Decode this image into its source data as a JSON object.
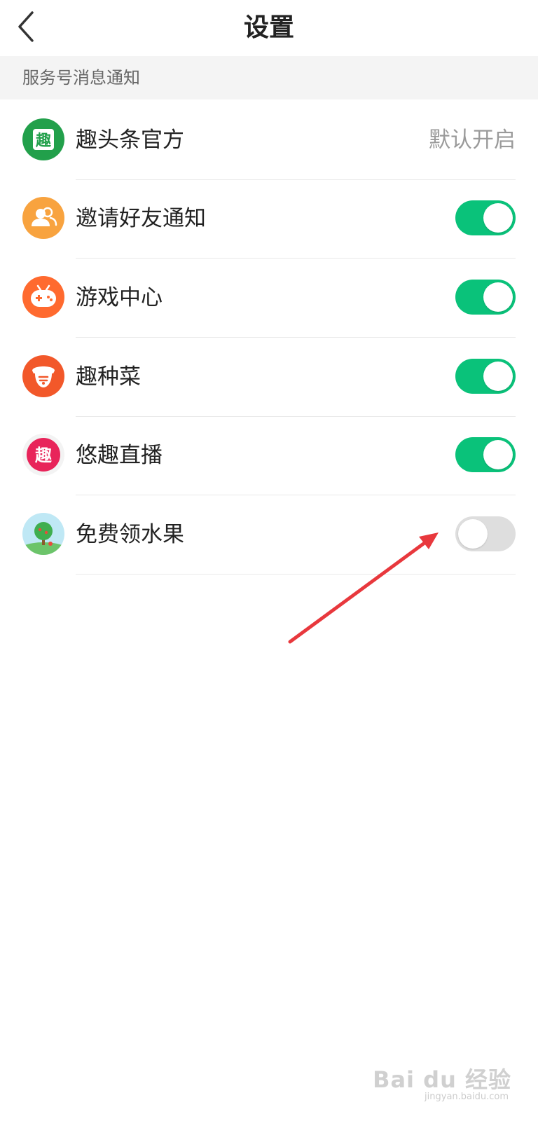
{
  "header": {
    "title": "设置",
    "back_icon": "chevron-left-icon"
  },
  "section": {
    "title": "服务号消息通知"
  },
  "rows": [
    {
      "label": "趣头条官方",
      "status_text": "默认开启",
      "icon": "qutoutiao-logo-icon",
      "icon_glyph": "趣",
      "icon_color": "#22a04b",
      "control": "status"
    },
    {
      "label": "邀请好友通知",
      "toggle_on": true,
      "icon": "friends-icon",
      "icon_color": "#f8a33f",
      "control": "toggle"
    },
    {
      "label": "游戏中心",
      "toggle_on": true,
      "icon": "gamepad-icon",
      "icon_color": "#ff6a2f",
      "control": "toggle"
    },
    {
      "label": "趣种菜",
      "toggle_on": true,
      "icon": "acorn-icon",
      "icon_color": "#f2582a",
      "control": "toggle"
    },
    {
      "label": "悠趣直播",
      "toggle_on": true,
      "icon": "youqu-live-logo-icon",
      "icon_glyph": "趣",
      "icon_color": "#e8245a",
      "control": "toggle"
    },
    {
      "label": "免费领水果",
      "toggle_on": false,
      "icon": "fruit-tree-icon",
      "icon_color": "#4cc28a",
      "control": "toggle"
    }
  ],
  "colors": {
    "toggle_on": "#0ac27a",
    "toggle_off": "#dedede",
    "annotation_arrow": "#e8383d"
  },
  "watermark": {
    "main": "Bai du 经验",
    "sub": "jingyan.baidu.com"
  }
}
